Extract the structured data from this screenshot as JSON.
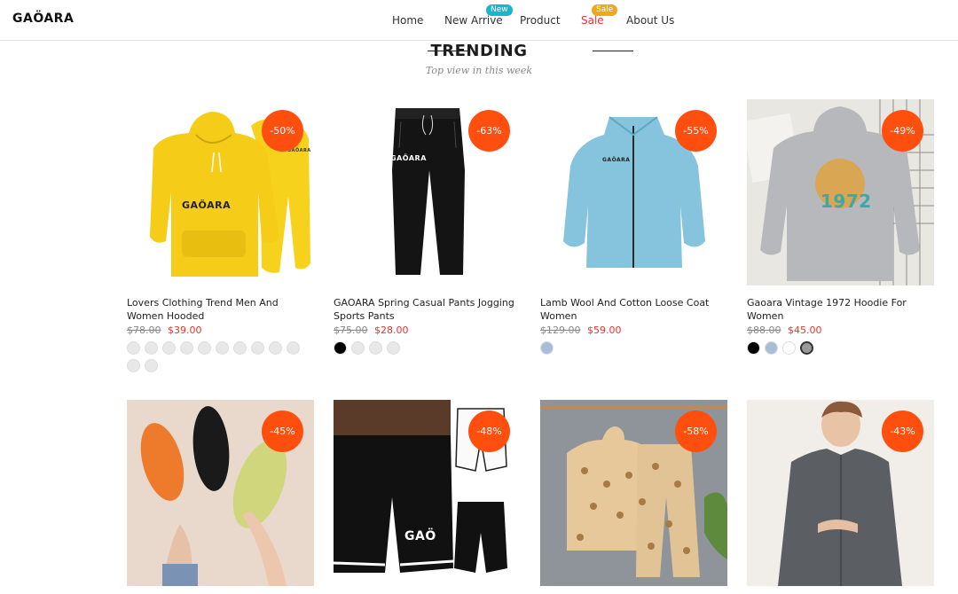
{
  "header": {
    "logo": "GAÖARA",
    "nav": {
      "home": "Home",
      "new_arrive": "New Arrive",
      "new_badge": "New",
      "product": "Product",
      "sale": "Sale",
      "sale_badge": "Sale",
      "about": "About Us"
    }
  },
  "section": {
    "title": "TRENDING",
    "subtitle": "Top view in this week"
  },
  "colors": {
    "discount_badge": "#ff4f0f",
    "sale_price": "#e8332b",
    "new_badge": "#1bb5c9",
    "sale_badge": "#f2a71b"
  },
  "products": [
    {
      "name": "Lovers Clothing Trend Men And Women Hooded",
      "discount": "-50%",
      "old_price": "$78.00",
      "price": "$39.00",
      "image": "yellow-hoodie-set",
      "print": "GAÖARA",
      "swatches": [
        "#e8e8e8",
        "#e8e8e8",
        "#e8e8e8",
        "#e8e8e8",
        "#e8e8e8",
        "#e8e8e8",
        "#e8e8e8",
        "#e8e8e8",
        "#e8e8e8",
        "#e8e8e8",
        "#e8e8e8",
        "#e8e8e8"
      ]
    },
    {
      "name": "GAOARA Spring Casual Pants Jogging Sports Pants",
      "discount": "-63%",
      "old_price": "$75.00",
      "price": "$28.00",
      "image": "black-jogging-pants",
      "print": "GAÖARA",
      "swatches": [
        "#000000",
        "#e8e8e8",
        "#e8e8e8",
        "#e8e8e8"
      ]
    },
    {
      "name": "Lamb Wool And Cotton Loose Coat Women",
      "discount": "-55%",
      "old_price": "$129.00",
      "price": "$59.00",
      "image": "blue-fleece-coat",
      "print": "GAÖARA",
      "swatches": [
        "#a9bcd8"
      ]
    },
    {
      "name": "Gaoara Vintage 1972 Hoodie For Women",
      "discount": "-49%",
      "old_price": "$88.00",
      "price": "$45.00",
      "image": "grey-vintage-hoodie",
      "print": "1972",
      "swatches": [
        "#000000",
        "#a9bcd8",
        "#ffffff",
        "#9a9a9a"
      ]
    },
    {
      "name": "",
      "discount": "-45%",
      "old_price": "",
      "price": "",
      "image": "slippers",
      "swatches": []
    },
    {
      "name": "",
      "discount": "-48%",
      "old_price": "",
      "price": "",
      "image": "basketball-shorts",
      "print": "GAÖ",
      "swatches": []
    },
    {
      "name": "",
      "discount": "-58%",
      "old_price": "",
      "price": "",
      "image": "kids-leopard-set",
      "swatches": []
    },
    {
      "name": "",
      "discount": "-43%",
      "old_price": "",
      "price": "",
      "image": "grey-shirt-model",
      "swatches": []
    }
  ]
}
